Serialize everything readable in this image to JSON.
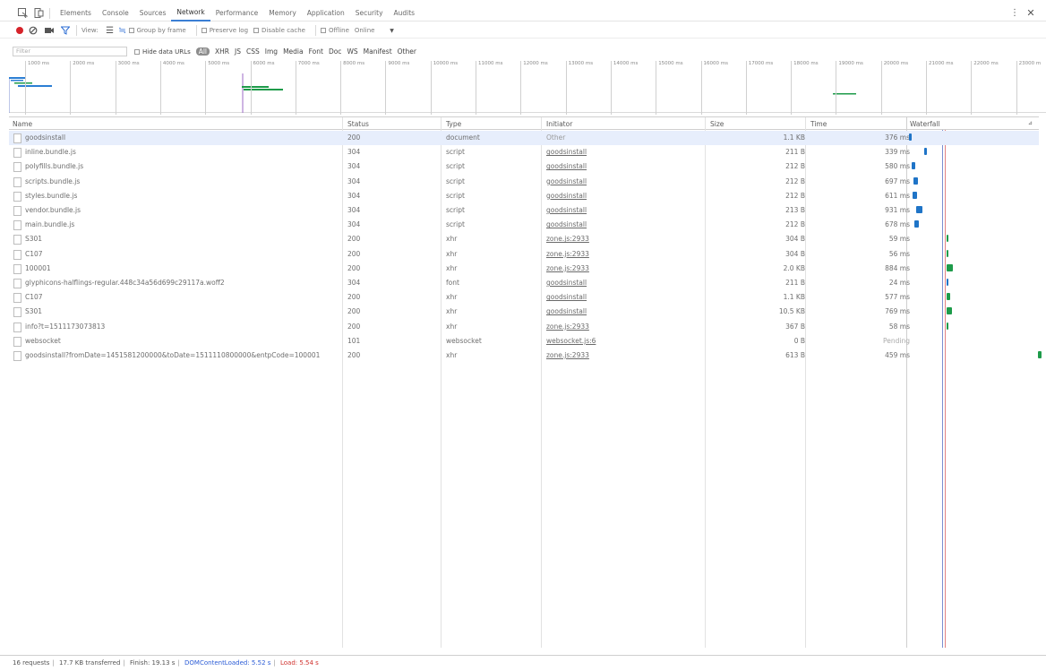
{
  "tabs": [
    "Elements",
    "Console",
    "Sources",
    "Network",
    "Performance",
    "Memory",
    "Application",
    "Security",
    "Audits"
  ],
  "toolbar": {
    "view_label": "View:",
    "group_by_frame": "Group by frame",
    "preserve_log": "Preserve log",
    "disable_cache": "Disable cache",
    "offline": "Offline",
    "online": "Online"
  },
  "filter": {
    "placeholder": "Filter",
    "hide_data_urls": "Hide data URLs",
    "types": [
      "All",
      "XHR",
      "JS",
      "CSS",
      "Img",
      "Media",
      "Font",
      "Doc",
      "WS",
      "Manifest",
      "Other"
    ]
  },
  "ruler_ticks": [
    "1000 ms",
    "2000 ms",
    "3000 ms",
    "4000 ms",
    "5000 ms",
    "6000 ms",
    "7000 ms",
    "8000 ms",
    "9000 ms",
    "10000 ms",
    "11000 ms",
    "12000 ms",
    "13000 ms",
    "14000 ms",
    "15000 ms",
    "16000 ms",
    "17000 ms",
    "18000 ms",
    "19000 ms",
    "20000 ms",
    "21000 ms",
    "22000 ms",
    "23000 m"
  ],
  "columns": {
    "name": "Name",
    "status": "Status",
    "type": "Type",
    "initiator": "Initiator",
    "size": "Size",
    "time": "Time",
    "waterfall": "Waterfall"
  },
  "requests": [
    {
      "name": "goodsinstall",
      "status": "200",
      "type": "document",
      "initiator": "Other",
      "size": "1.1 KB",
      "time": "376 ms"
    },
    {
      "name": "inline.bundle.js",
      "status": "304",
      "type": "script",
      "initiator": "goodsinstall",
      "size": "211 B",
      "time": "339 ms"
    },
    {
      "name": "polyfills.bundle.js",
      "status": "304",
      "type": "script",
      "initiator": "goodsinstall",
      "size": "212 B",
      "time": "580 ms"
    },
    {
      "name": "scripts.bundle.js",
      "status": "304",
      "type": "script",
      "initiator": "goodsinstall",
      "size": "212 B",
      "time": "697 ms"
    },
    {
      "name": "styles.bundle.js",
      "status": "304",
      "type": "script",
      "initiator": "goodsinstall",
      "size": "212 B",
      "time": "611 ms"
    },
    {
      "name": "vendor.bundle.js",
      "status": "304",
      "type": "script",
      "initiator": "goodsinstall",
      "size": "213 B",
      "time": "931 ms"
    },
    {
      "name": "main.bundle.js",
      "status": "304",
      "type": "script",
      "initiator": "goodsinstall",
      "size": "212 B",
      "time": "678 ms"
    },
    {
      "name": "S301",
      "status": "200",
      "type": "xhr",
      "initiator": "zone.js:2933",
      "size": "304 B",
      "time": "59 ms"
    },
    {
      "name": "C107",
      "status": "200",
      "type": "xhr",
      "initiator": "zone.js:2933",
      "size": "304 B",
      "time": "56 ms"
    },
    {
      "name": "100001",
      "status": "200",
      "type": "xhr",
      "initiator": "zone.js:2933",
      "size": "2.0 KB",
      "time": "884 ms"
    },
    {
      "name": "glyphicons-halflings-regular.448c34a56d699c29117a.woff2",
      "status": "304",
      "type": "font",
      "initiator": "goodsinstall",
      "size": "211 B",
      "time": "24 ms"
    },
    {
      "name": "C107",
      "status": "200",
      "type": "xhr",
      "initiator": "goodsinstall",
      "size": "1.1 KB",
      "time": "577 ms"
    },
    {
      "name": "S301",
      "status": "200",
      "type": "xhr",
      "initiator": "goodsinstall",
      "size": "10.5 KB",
      "time": "769 ms"
    },
    {
      "name": "info?t=1511173073813",
      "status": "200",
      "type": "xhr",
      "initiator": "zone.js:2933",
      "size": "367 B",
      "time": "58 ms"
    },
    {
      "name": "websocket",
      "status": "101",
      "type": "websocket",
      "initiator": "websocket.js:6",
      "size": "0 B",
      "time": "Pending"
    },
    {
      "name": "goodsinstall?fromDate=1451581200000&toDate=1511110800000&entpCode=100001",
      "status": "200",
      "type": "xhr",
      "initiator": "zone.js:2933",
      "size": "613 B",
      "time": "459 ms"
    }
  ],
  "waterfall_colors": {
    "document": "#1f74c7",
    "script": "#1f74c7",
    "xhr": "#1e9b4a",
    "font": "#1f74c7",
    "websocket": "#1e9b4a"
  },
  "statusbar": {
    "requests": "16 requests",
    "transferred": "17.7 KB transferred",
    "finish": "Finish: 19.13 s",
    "dcl": "DOMContentLoaded: 5.52 s",
    "load": "Load: 5.54 s"
  }
}
